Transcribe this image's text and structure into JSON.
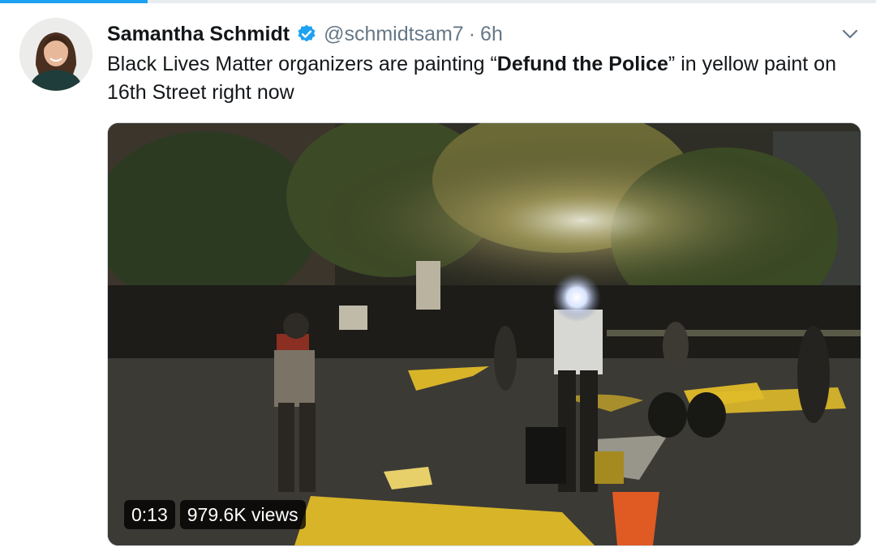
{
  "tweet": {
    "display_name": "Samantha Schmidt",
    "handle": "@schmidtsam7",
    "separator": "·",
    "time": "6h",
    "text_before": "Black Lives Matter organizers are painting “",
    "text_bold": "Defund the Police",
    "text_after": "” in yellow paint on 16th Street right now",
    "verified": true
  },
  "media": {
    "duration": "0:13",
    "views": "979.6K views"
  },
  "icons": {
    "verified": "verified-badge-icon",
    "menu": "chevron-down-icon"
  },
  "colors": {
    "accent": "#1da1f2",
    "text": "#14171a",
    "muted": "#657786",
    "paint": "#f2c40c"
  }
}
